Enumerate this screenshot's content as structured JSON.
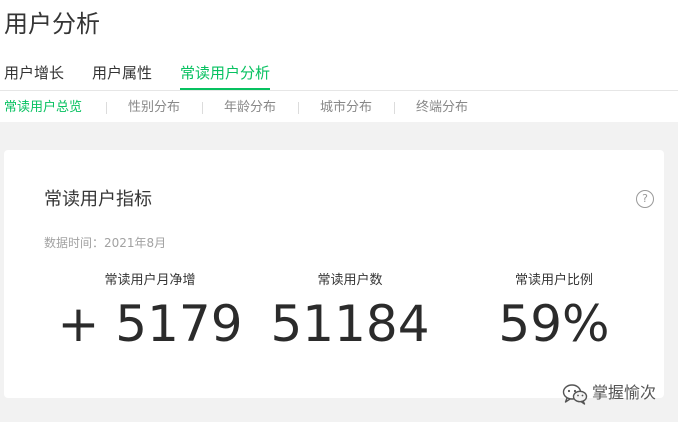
{
  "page": {
    "title": "用户分析"
  },
  "main_tabs": [
    {
      "label": "用户增长",
      "active": false
    },
    {
      "label": "用户属性",
      "active": false
    },
    {
      "label": "常读用户分析",
      "active": true
    }
  ],
  "sub_tabs": [
    {
      "label": "常读用户总览",
      "active": true
    },
    {
      "label": "性别分布",
      "active": false
    },
    {
      "label": "年龄分布",
      "active": false
    },
    {
      "label": "城市分布",
      "active": false
    },
    {
      "label": "终端分布",
      "active": false
    }
  ],
  "card": {
    "title": "常读用户指标",
    "help_icon": "question-circle-icon",
    "data_time": "数据时间：2021年8月",
    "metrics": [
      {
        "label": "常读用户月净增",
        "value": "+ 5179"
      },
      {
        "label": "常读用户数",
        "value": "51184"
      },
      {
        "label": "常读用户比例",
        "value": "59%"
      }
    ]
  },
  "watermark": {
    "icon": "wechat-icon",
    "text": "掌握愉次"
  },
  "colors": {
    "accent": "#07c160",
    "background": "#f2f2f2",
    "card": "#ffffff"
  }
}
